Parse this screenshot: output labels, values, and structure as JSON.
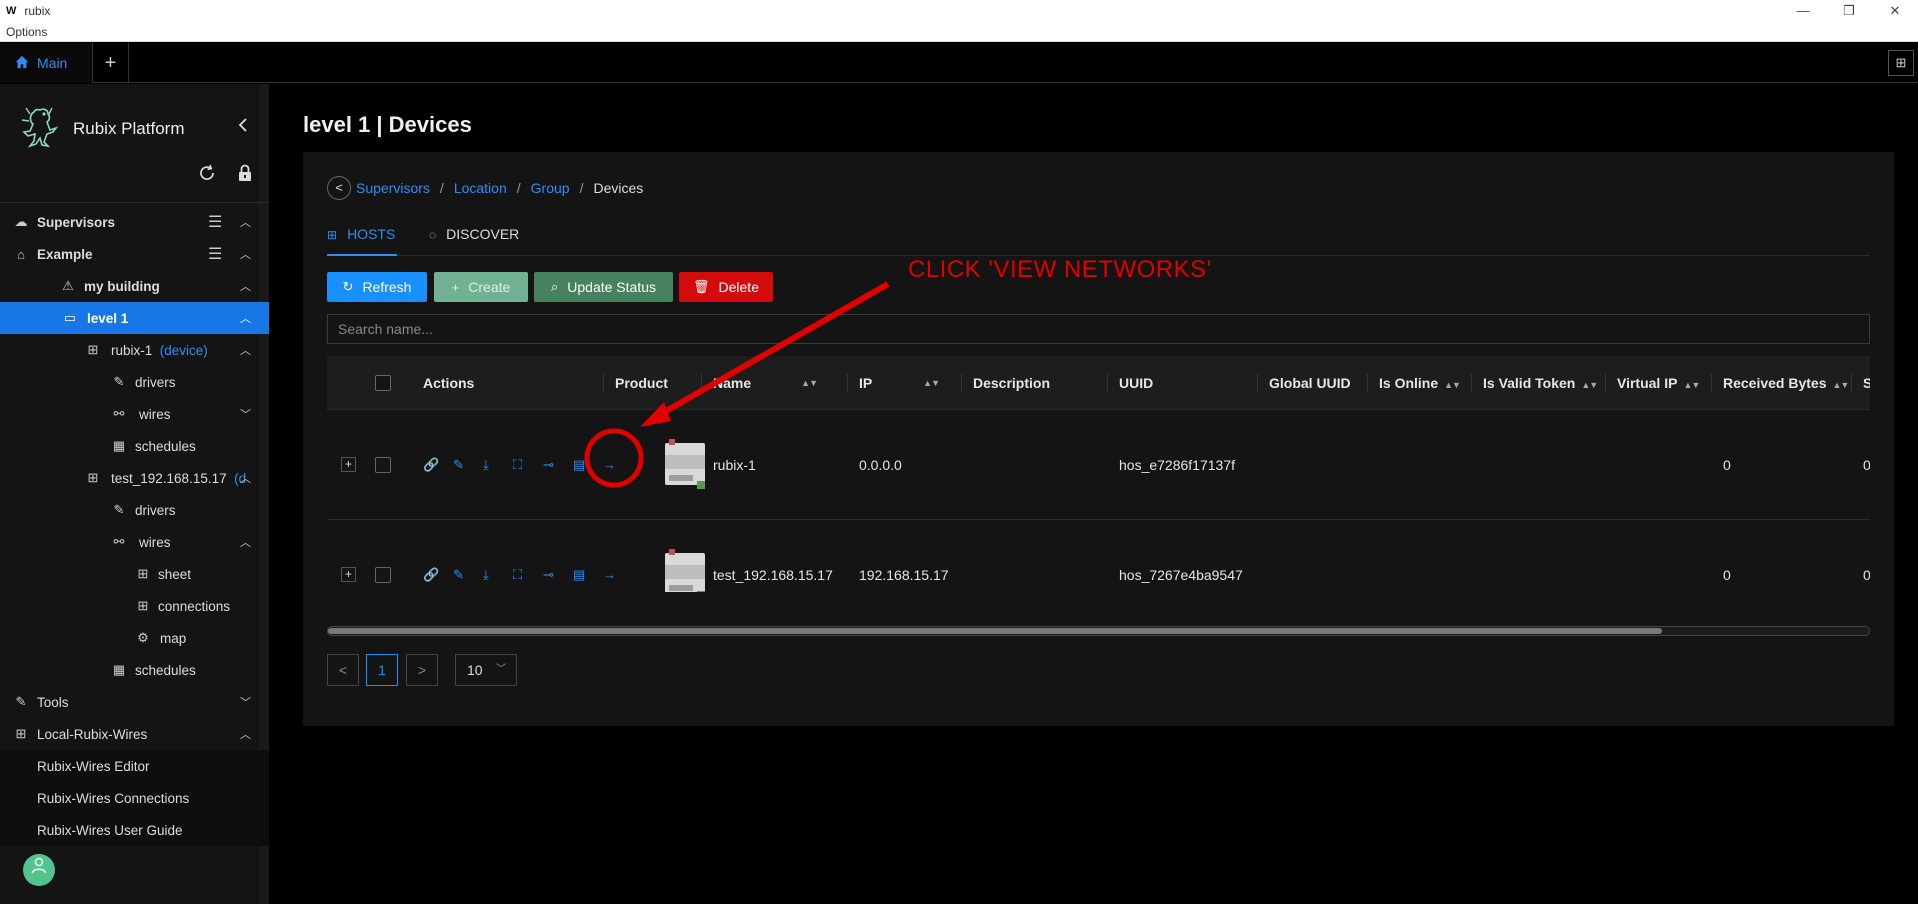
{
  "window": {
    "logo": "W",
    "title": "rubix",
    "menu": "Options",
    "controls": [
      "—",
      "❐",
      "✕"
    ]
  },
  "tabbar": {
    "main_tab": "Main",
    "add_tab": "+",
    "layout_icon": "⊞"
  },
  "sidebar": {
    "brand": "Rubix Platform",
    "items": [
      {
        "label": "Supervisors",
        "tag": ""
      },
      {
        "label": "Example",
        "tag": ""
      },
      {
        "label": "my building",
        "tag": ""
      },
      {
        "label": "level 1",
        "tag": ""
      },
      {
        "label": "rubix-1",
        "tag": "(device)"
      },
      {
        "label": "drivers",
        "tag": ""
      },
      {
        "label": "wires",
        "tag": ""
      },
      {
        "label": "schedules",
        "tag": ""
      },
      {
        "label": "test_192.168.15.17",
        "tag": "(d"
      },
      {
        "label": "drivers",
        "tag": ""
      },
      {
        "label": "wires",
        "tag": ""
      },
      {
        "label": "sheet",
        "tag": ""
      },
      {
        "label": "connections",
        "tag": ""
      },
      {
        "label": "map",
        "tag": ""
      },
      {
        "label": "schedules",
        "tag": ""
      },
      {
        "label": "Tools",
        "tag": ""
      },
      {
        "label": "Local-Rubix-Wires",
        "tag": ""
      },
      {
        "label": "Rubix-Wires Editor",
        "tag": ""
      },
      {
        "label": "Rubix-Wires Connections",
        "tag": ""
      },
      {
        "label": "Rubix-Wires User Guide",
        "tag": ""
      }
    ]
  },
  "page": {
    "title": "level 1 | Devices"
  },
  "breadcrumb": {
    "items": [
      "Supervisors",
      "Location",
      "Group"
    ],
    "current": "Devices",
    "separator": "/"
  },
  "tabs": {
    "hosts": "HOSTS",
    "discover": "DISCOVER"
  },
  "buttons": {
    "refresh": "Refresh",
    "create": "Create",
    "update_status": "Update Status",
    "delete": "Delete"
  },
  "search": {
    "placeholder": "Search name..."
  },
  "table": {
    "headers": [
      "Actions",
      "Product",
      "Name",
      "IP",
      "Description",
      "UUID",
      "Global UUID",
      "Is Online",
      "Is Valid Token",
      "Virtual IP",
      "Received Bytes",
      "S"
    ],
    "rows": [
      {
        "name": "rubix-1",
        "ip": "0.0.0.0",
        "description": "",
        "uuid": "hos_e7286f17137f",
        "global_uuid": "",
        "received_bytes": "0",
        "next": "0"
      },
      {
        "name": "test_192.168.15.17",
        "ip": "192.168.15.17",
        "description": "",
        "uuid": "hos_7267e4ba9547",
        "global_uuid": "",
        "received_bytes": "0",
        "next": "0"
      }
    ]
  },
  "pagination": {
    "prev": "<",
    "page": "1",
    "next": ">",
    "page_size": "10"
  },
  "annotation": {
    "text": "CLICK 'VIEW NETWORKS'",
    "color": "#e00000"
  },
  "colors": {
    "accent": "#1890ff",
    "link": "#2f8ef5",
    "danger": "#d40b0b",
    "success": "#48815e"
  }
}
